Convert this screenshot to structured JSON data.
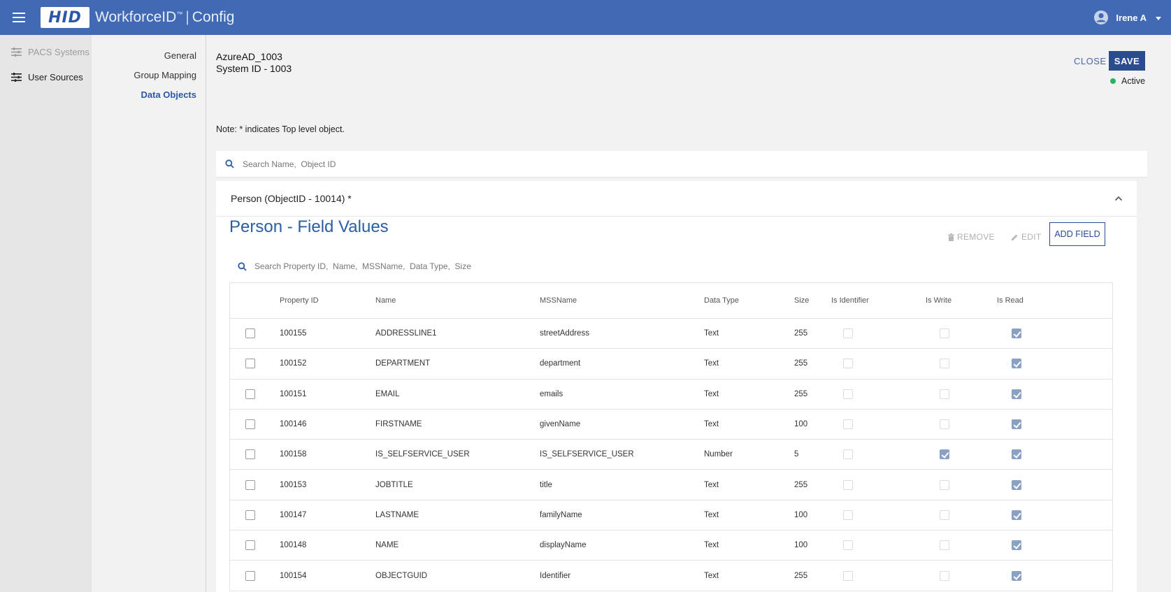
{
  "header": {
    "logo_text": "HID",
    "product_name": "WorkforceID",
    "product_mark": "™",
    "product_separator": "|",
    "product_module": "Config",
    "user_name": "Irene A"
  },
  "sidebar": {
    "items": [
      {
        "label": "PACS Systems",
        "icon": "sliders-icon",
        "state": "dim"
      },
      {
        "label": "User Sources",
        "icon": "sliders-icon",
        "state": "active"
      }
    ]
  },
  "subnav": {
    "items": [
      {
        "label": "General"
      },
      {
        "label": "Group Mapping"
      },
      {
        "label": "Data Objects",
        "active": true
      }
    ]
  },
  "system": {
    "name": "AzureAD_1003",
    "system_id": "System ID - 1003",
    "status": "Active",
    "status_color": "#28b463"
  },
  "actions": {
    "close": "CLOSE",
    "save": "SAVE",
    "remove": "REMOVE",
    "edit": "EDIT",
    "add_field": "ADD FIELD"
  },
  "note": "Note: * indicates Top level object.",
  "search": {
    "placeholder": "Search Name,  Object ID"
  },
  "panel": {
    "header": "Person (ObjectID - 10014) *",
    "title": "Person - Field Values",
    "search_placeholder": "Search Property ID,  Name,  MSSName,  Data Type,  Size"
  },
  "table": {
    "columns": {
      "property_id": "Property ID",
      "name": "Name",
      "mss_name": "MSSName",
      "data_type": "Data Type",
      "size": "Size",
      "is_identifier": "Is Identifier",
      "is_write": "Is Write",
      "is_read": "Is Read"
    },
    "rows": [
      {
        "property_id": "100155",
        "name": "ADDRESSLINE1",
        "mss_name": "streetAddress",
        "data_type": "Text",
        "size": "255",
        "is_identifier": false,
        "is_write": false,
        "is_read": true
      },
      {
        "property_id": "100152",
        "name": "DEPARTMENT",
        "mss_name": "department",
        "data_type": "Text",
        "size": "255",
        "is_identifier": false,
        "is_write": false,
        "is_read": true
      },
      {
        "property_id": "100151",
        "name": "EMAIL",
        "mss_name": "emails",
        "data_type": "Text",
        "size": "255",
        "is_identifier": false,
        "is_write": false,
        "is_read": true
      },
      {
        "property_id": "100146",
        "name": "FIRSTNAME",
        "mss_name": "givenName",
        "data_type": "Text",
        "size": "100",
        "is_identifier": false,
        "is_write": false,
        "is_read": true
      },
      {
        "property_id": "100158",
        "name": "IS_SELFSERVICE_USER",
        "mss_name": "IS_SELFSERVICE_USER",
        "data_type": "Number",
        "size": "5",
        "is_identifier": false,
        "is_write": true,
        "is_read": true
      },
      {
        "property_id": "100153",
        "name": "JOBTITLE",
        "mss_name": "title",
        "data_type": "Text",
        "size": "255",
        "is_identifier": false,
        "is_write": false,
        "is_read": true
      },
      {
        "property_id": "100147",
        "name": "LASTNAME",
        "mss_name": "familyName",
        "data_type": "Text",
        "size": "100",
        "is_identifier": false,
        "is_write": false,
        "is_read": true
      },
      {
        "property_id": "100148",
        "name": "NAME",
        "mss_name": "displayName",
        "data_type": "Text",
        "size": "100",
        "is_identifier": false,
        "is_write": false,
        "is_read": true
      },
      {
        "property_id": "100154",
        "name": "OBJECTGUID",
        "mss_name": "Identifier",
        "data_type": "Text",
        "size": "255",
        "is_identifier": false,
        "is_write": false,
        "is_read": true
      }
    ]
  }
}
